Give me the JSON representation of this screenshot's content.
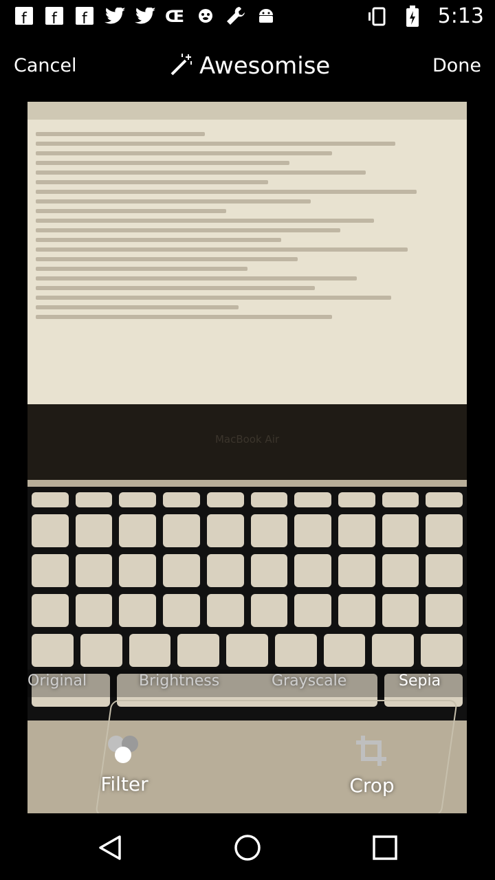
{
  "status_bar": {
    "time": "5:13",
    "left_icons": [
      "facebook-icon",
      "facebook-icon",
      "facebook-icon",
      "twitter-icon",
      "twitter-icon",
      "ce-icon",
      "monkey-icon",
      "wrench-icon",
      "android-icon"
    ],
    "right_icons": [
      "vibrate-icon",
      "battery-charging-icon"
    ]
  },
  "action_bar": {
    "cancel_label": "Cancel",
    "title": "Awesomise",
    "done_label": "Done"
  },
  "photo": {
    "brand_text": "MacBook Air"
  },
  "filters": [
    {
      "label": "Original",
      "selected": false
    },
    {
      "label": "Brightness",
      "selected": false
    },
    {
      "label": "Grayscale",
      "selected": false
    },
    {
      "label": "Sepia",
      "selected": true
    }
  ],
  "tools": [
    {
      "label": "Filter",
      "icon": "filter-icon"
    },
    {
      "label": "Crop",
      "icon": "crop-icon"
    }
  ],
  "nav": [
    "back-icon",
    "home-icon",
    "recents-icon"
  ]
}
